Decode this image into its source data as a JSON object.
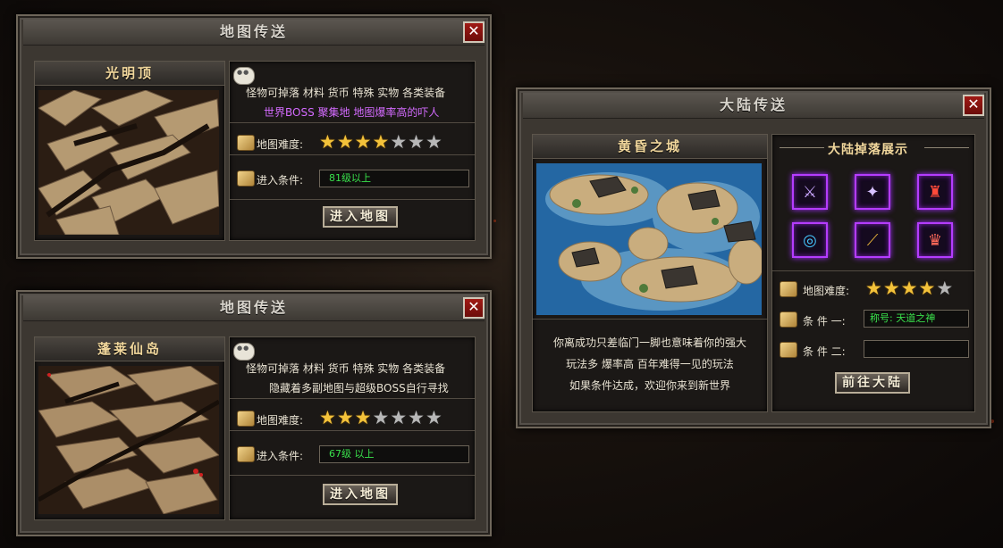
{
  "panel_top": {
    "title": "地图传送",
    "close": "✕",
    "map_name": "光明顶",
    "line1": "怪物可掉落  材料  货币  特殊  实物  各类装备",
    "line2": "世界BOSS 聚集地  地图爆率高的吓人",
    "difficulty_label": "地图难度:",
    "difficulty": 4,
    "difficulty_max": 7,
    "condition_label": "进入条件:",
    "condition_value": "81级以上",
    "button": "进入地图"
  },
  "panel_bottom": {
    "title": "地图传送",
    "close": "✕",
    "map_name": "蓬莱仙岛",
    "line1": "怪物可掉落  材料  货币  特殊  实物  各类装备",
    "line2": "隐藏着多副地图与超级BOSS自行寻找",
    "difficulty_label": "地图难度:",
    "difficulty": 3,
    "difficulty_max": 7,
    "condition_label": "进入条件:",
    "condition_value": "67级  以上",
    "button": "进入地图"
  },
  "continent": {
    "title": "大陆传送",
    "close": "✕",
    "map_name": "黄昏之城",
    "drops_title": "大陆掉落展示",
    "items": [
      "purple-blade-icon",
      "purple-claw-icon",
      "red-armor-icon",
      "blue-ring-icon",
      "golden-staff-icon",
      "red-helmet-icon"
    ],
    "desc1": "你离成功只差临门一脚也意味着你的强大",
    "desc2": "玩法多  爆率高  百年难得一见的玩法",
    "desc3": "如果条件达成，欢迎你来到新世界",
    "difficulty_label": "地图难度:",
    "difficulty": 4,
    "difficulty_max": 5,
    "cond1_label": "条  件  一:",
    "cond1_value": "称号: 天道之神",
    "cond2_label": "条  件  二:",
    "cond2_value": "",
    "button": "前往大陆"
  },
  "colors": {
    "star_on": "#f3c23a",
    "star_off": "#b7b7b7",
    "info_purple": "#d46bff",
    "condition_green": "#39e04b",
    "close_red": "#a01a15",
    "item_glow": "#b43cff"
  }
}
